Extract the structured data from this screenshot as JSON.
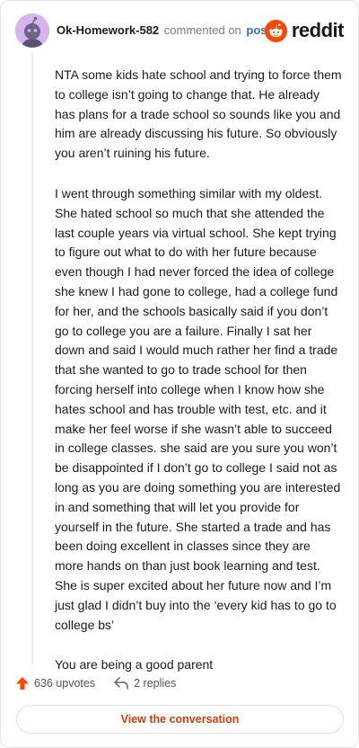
{
  "comment": {
    "username": "Ok-Homework-582",
    "commented_on_text": "commented on",
    "post_link_text": "post",
    "paragraphs": [
      "NTA some kids hate school and trying to force them to college isn’t going to change that. He already has plans for a trade school so sounds like you and him are already discussing his future. So obviously you aren’t ruining his future.",
      "I went through something similar with my oldest. She hated school so much that she attended the last couple years via virtual school. She kept trying to figure out what to do with her future because even though I had never forced the idea of college she knew I had gone to college, had a college fund for her, and the schools basically said if you don’t go to college you are a failure. Finally I sat her down and said I would much rather her find a trade that she wanted to go to trade school for then forcing herself into college when I know how she hates school and has trouble with test, etc. and it make her feel worse if she wasn’t able to succeed in college classes. she said are you sure you won’t be disappointed if I don’t go to college I said not as long as you are doing something you are interested in and something that will let you provide for yourself in the future. She started a trade and has been doing excellent in classes since they are more hands on than just book learning and test. She is super excited about her future now and I’m just glad I didn’t buy into the ‘every kid has to go to college bs’",
      "You are being a good parent"
    ],
    "upvotes_text": "636 upvotes",
    "replies_text": "2 replies"
  },
  "brand": {
    "name": "reddit",
    "icon": "reddit-logo-icon",
    "color": "#ff4500"
  },
  "cta": {
    "label": "View the conversation"
  },
  "colors": {
    "accent": "#d93a00",
    "upvote": "#ff4500",
    "link": "#3b66c4"
  }
}
